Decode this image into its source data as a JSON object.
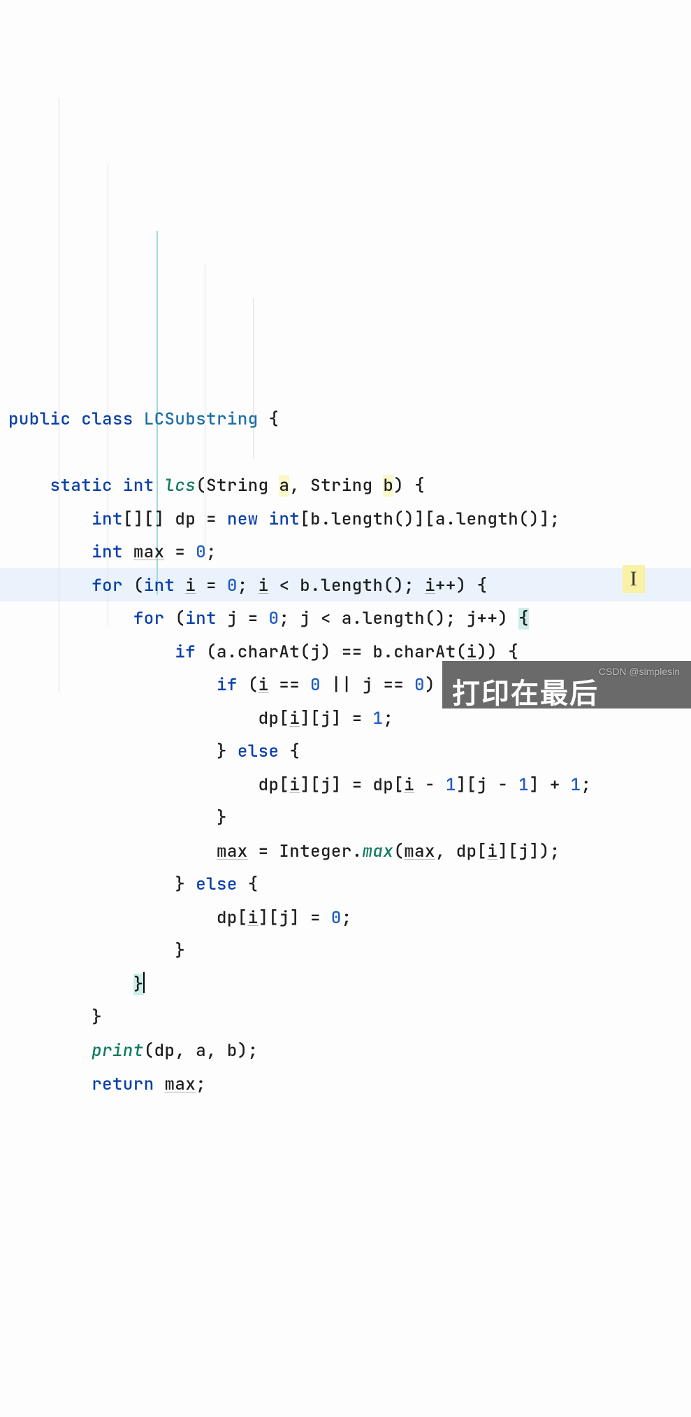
{
  "code": {
    "line1": {
      "public": "public",
      "class": "class",
      "name": "LCSubstring",
      "brace": "{"
    },
    "line3": {
      "static": "static",
      "int": "int",
      "fn": "lcs",
      "p_String1": "String",
      "a": "a",
      "comma": ",",
      "p_String2": "String",
      "b": "b",
      "close": ") {"
    },
    "line4": {
      "int": "int",
      "arr": "[][]",
      "dp": "dp",
      "eq": "=",
      "new": "new",
      "int2": "int",
      "expr": "[b.length()][a.length()];"
    },
    "line5": {
      "int": "int",
      "max": "max",
      "eq": "= ",
      "zero": "0",
      "semi": ";"
    },
    "line6": {
      "for": "for",
      "open": "(",
      "int": "int",
      "i": "i",
      "eq": " = ",
      "zero": "0",
      "cond": "; ",
      "i2": "i",
      "lt": " < b.length(); ",
      "i3": "i",
      "inc": "++) {"
    },
    "line7": {
      "for": "for",
      "open": "(",
      "int": "int",
      "j": "j",
      "eq": " = ",
      "zero": "0",
      "cond": "; j < a.length(); j++) ",
      "brace": "{"
    },
    "line8": {
      "if": "if",
      "open": " (a.charAt(j) == b.charAt(",
      "i": "i",
      "close": ")) {"
    },
    "line9": {
      "if": "if",
      "open": " (",
      "i": "i",
      "eq1": " == ",
      "z1": "0",
      "or": " || j == ",
      "z2": "0",
      "close": ") {"
    },
    "line10": {
      "expr1": "dp[",
      "i": "i",
      "expr2": "][j] = ",
      "one": "1",
      "semi": ";"
    },
    "line11": {
      "close": "}",
      "else": "else",
      "brace": "{"
    },
    "line12": {
      "expr1": "dp[",
      "i1": "i",
      "mid1": "][j] = dp[",
      "i2": "i",
      "mid2": " - ",
      "n1": "1",
      "mid3": "][j - ",
      "n2": "1",
      "mid4": "] + ",
      "n3": "1",
      "semi": ";"
    },
    "line13": {
      "close": "}"
    },
    "line14": {
      "max": "max",
      "eq": " = Integer.",
      "fn": "max",
      "open": "(",
      "max2": "max",
      "mid": ", dp[",
      "i": "i",
      "close": "][j]);"
    },
    "line15": {
      "close": "}",
      "else": "else",
      "brace": "{"
    },
    "line16": {
      "expr1": "dp[",
      "i": "i",
      "expr2": "][j] = ",
      "zero": "0",
      "semi": ";"
    },
    "line17": {
      "close": "}"
    },
    "line18": {
      "close": "}"
    },
    "line19": {
      "close": "}"
    },
    "line20": {
      "print": "print",
      "args": "(dp, a, b);"
    },
    "line21": {
      "return": "return",
      "max": "max",
      "semi": ";"
    }
  },
  "overlay": {
    "banner": "打印在最后",
    "watermark": "CSDN @simplesin"
  }
}
